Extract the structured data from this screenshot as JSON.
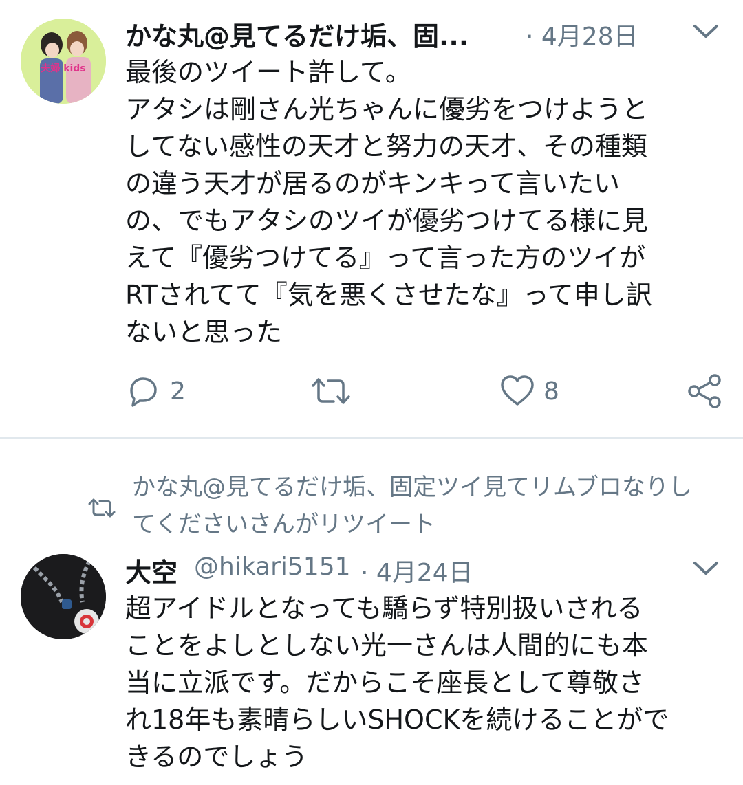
{
  "tweet1": {
    "author_name": "かな丸@見てるだけ垢、固...",
    "meta": "· 4月28日",
    "lines": [
      "最後のツイート許して。",
      "アタシは剛さん光ちゃんに優劣をつけようと",
      "してない感性の天才と努力の天才、その種類",
      "の違う天才が居るのがキンキって言いたい",
      "の、でもアタシのツイが優劣つけてる様に見",
      "えて『優劣つけてる』って言った方のツイが",
      "RTされてて『気を悪くさせたな』って申し訳",
      "ないと思った"
    ],
    "avatar_text": "夫婦 kids",
    "reply_count": "2",
    "retweet_count": "",
    "like_count": "8"
  },
  "retweet_context": {
    "line1": "かな丸@見てるだけ垢、固定ツイ見てリムブロなりし",
    "line2": "てくださいさんがリツイート"
  },
  "tweet2": {
    "author_name": "大空",
    "handle": "@hikari5151",
    "meta": "· 4月24日",
    "lines": [
      "超アイドルとなっても驕らず特別扱いされる",
      "ことをよしとしない光一さんは人間的にも本",
      "当に立派です。だからこそ座長として尊敬さ",
      "れ18年も素晴らしいSHOCKを続けることがで",
      "きるのでしょう"
    ]
  },
  "colors": {
    "text": "#14171a",
    "secondary": "#657786",
    "divider": "#e1e8ed",
    "avatar1_bg": "#d9ef9a",
    "avatar2_bg": "#1b1b1d"
  }
}
